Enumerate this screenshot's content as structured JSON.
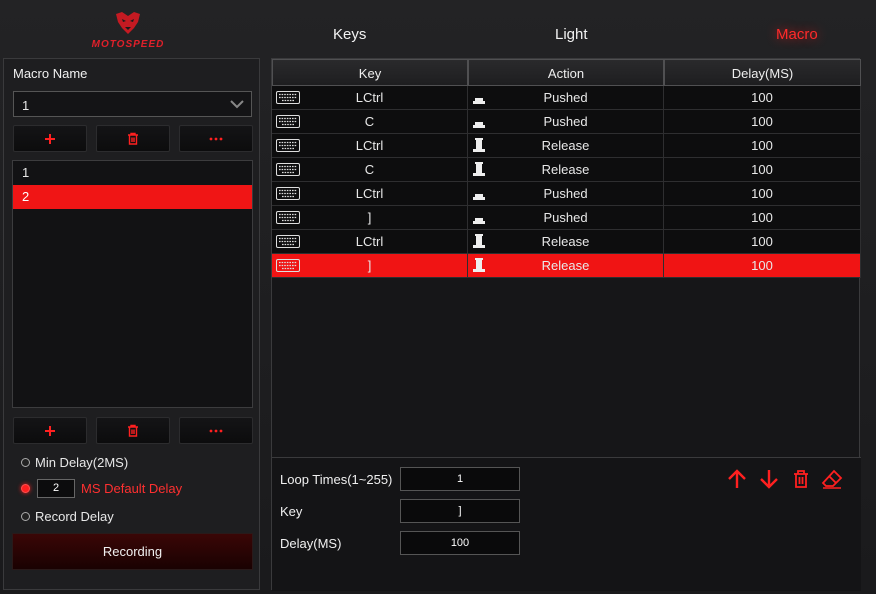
{
  "brand": {
    "name": "MOTOSPEED",
    "color": "#e0202a"
  },
  "nav": {
    "tabs": [
      {
        "label": "Keys",
        "active": false
      },
      {
        "label": "Light",
        "active": false
      },
      {
        "label": "Macro",
        "active": true
      }
    ]
  },
  "left": {
    "macro_name_label": "Macro Name",
    "selected_macro": "1",
    "top_buttons": [
      "add-icon",
      "trash-icon",
      "more-icon"
    ],
    "macros": [
      {
        "label": "1",
        "selected": false
      },
      {
        "label": "2",
        "selected": true
      }
    ],
    "bottom_buttons": [
      "add-icon",
      "trash-icon",
      "more-icon"
    ],
    "delay_options": {
      "min_delay": "Min Delay(2MS)",
      "default_delay_value": "2",
      "default_delay": "MS Default Delay",
      "record_delay": "Record Delay",
      "selected": "default_delay"
    },
    "record_button": "Recording"
  },
  "table": {
    "columns": [
      "Key",
      "Action",
      "Delay(MS)"
    ],
    "rows": [
      {
        "key": "LCtrl",
        "action": "Pushed",
        "delay": "100",
        "selected": false
      },
      {
        "key": "C",
        "action": "Pushed",
        "delay": "100",
        "selected": false
      },
      {
        "key": "LCtrl",
        "action": "Release",
        "delay": "100",
        "selected": false
      },
      {
        "key": "C",
        "action": "Release",
        "delay": "100",
        "selected": false
      },
      {
        "key": "LCtrl",
        "action": "Pushed",
        "delay": "100",
        "selected": false
      },
      {
        "key": "]",
        "action": "Pushed",
        "delay": "100",
        "selected": false
      },
      {
        "key": "LCtrl",
        "action": "Release",
        "delay": "100",
        "selected": false
      },
      {
        "key": "]",
        "action": "Release",
        "delay": "100",
        "selected": true
      }
    ]
  },
  "editor": {
    "loop_label": "Loop Times(1~255)",
    "loop_value": "1",
    "key_label": "Key",
    "key_value": "]",
    "delay_label": "Delay(MS)",
    "delay_value": "100",
    "actions": [
      "arrow-up-icon",
      "arrow-down-icon",
      "trash-icon",
      "clear-icon"
    ]
  },
  "colors": {
    "accent": "#f01414",
    "background": "#1c1c1e"
  }
}
